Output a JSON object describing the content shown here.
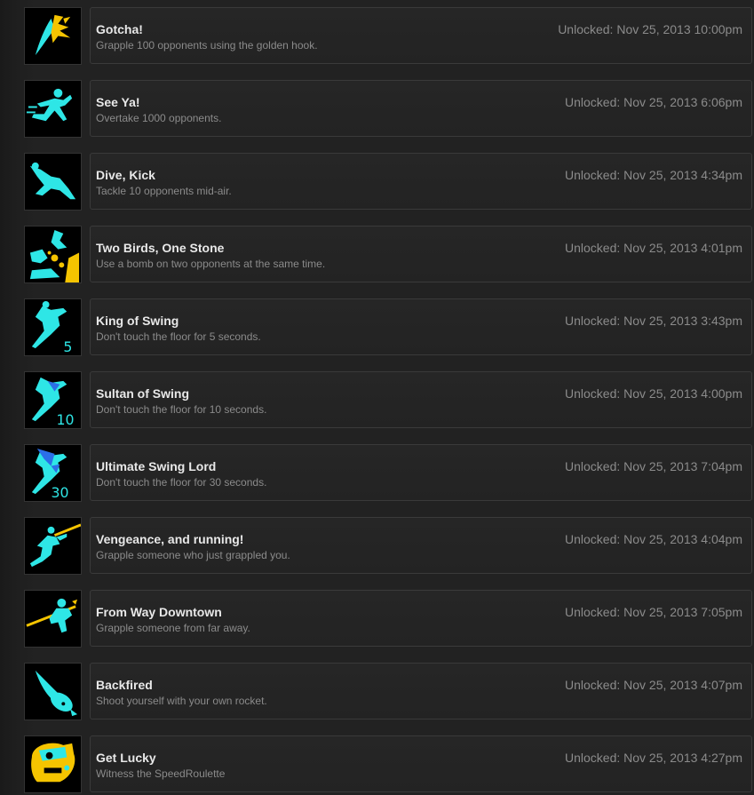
{
  "achievements": [
    {
      "title": "Gotcha!",
      "description": "Grapple 100 opponents using the golden hook.",
      "unlocked": "Unlocked: Nov 25, 2013 10:00pm",
      "icon": "golden-hook-icon"
    },
    {
      "title": "See Ya!",
      "description": "Overtake 1000 opponents.",
      "unlocked": "Unlocked: Nov 25, 2013 6:06pm",
      "icon": "running-figure-icon"
    },
    {
      "title": "Dive, Kick",
      "description": "Tackle 10 opponents mid-air.",
      "unlocked": "Unlocked: Nov 25, 2013 4:34pm",
      "icon": "dive-kick-icon"
    },
    {
      "title": "Two Birds, One Stone",
      "description": "Use a bomb on two opponents at the same time.",
      "unlocked": "Unlocked: Nov 25, 2013 4:01pm",
      "icon": "bomb-explosion-icon"
    },
    {
      "title": "King of Swing",
      "description": "Don't touch the floor for 5 seconds.",
      "unlocked": "Unlocked: Nov 25, 2013 3:43pm",
      "icon": "swing-5-icon",
      "icon_number": "5"
    },
    {
      "title": "Sultan of Swing",
      "description": "Don't touch the floor for 10 seconds.",
      "unlocked": "Unlocked: Nov 25, 2013 4:00pm",
      "icon": "swing-10-icon",
      "icon_number": "10"
    },
    {
      "title": "Ultimate Swing Lord",
      "description": "Don't touch the floor for 30 seconds.",
      "unlocked": "Unlocked: Nov 25, 2013 7:04pm",
      "icon": "swing-30-icon",
      "icon_number": "30"
    },
    {
      "title": "Vengeance, and running!",
      "description": "Grapple someone who just grappled you.",
      "unlocked": "Unlocked: Nov 25, 2013 4:04pm",
      "icon": "grapple-runner-icon"
    },
    {
      "title": "From Way Downtown",
      "description": "Grapple someone from far away.",
      "unlocked": "Unlocked: Nov 25, 2013 7:05pm",
      "icon": "long-grapple-icon"
    },
    {
      "title": "Backfired",
      "description": "Shoot yourself with your own rocket.",
      "unlocked": "Unlocked: Nov 25, 2013 4:07pm",
      "icon": "rocket-icon"
    },
    {
      "title": "Get Lucky",
      "description": "Witness the SpeedRoulette",
      "unlocked": "Unlocked: Nov 25, 2013 4:27pm",
      "icon": "roulette-face-icon"
    }
  ],
  "colors": {
    "cyan": "#2ee6e6",
    "gold": "#f5c400",
    "blue": "#2b6fe8"
  }
}
